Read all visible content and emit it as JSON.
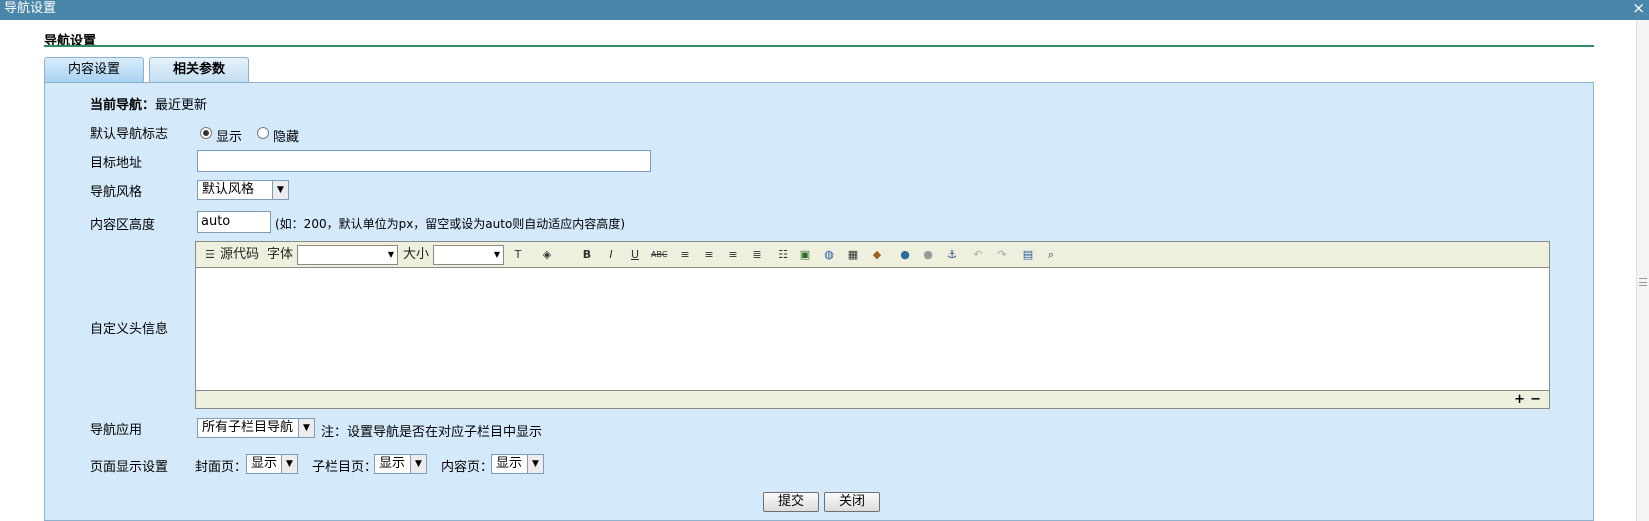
{
  "window": {
    "title": "导航设置",
    "close_glyph": "×"
  },
  "section": {
    "title": "导航设置"
  },
  "tabs": [
    {
      "label": "内容设置",
      "active": false
    },
    {
      "label": "相关参数",
      "active": true
    }
  ],
  "form": {
    "current_nav_label": "当前导航：",
    "current_nav_value": "最近更新",
    "default_flag_label": "默认导航标志",
    "flag_options": [
      {
        "label": "显示",
        "selected": true
      },
      {
        "label": "隐藏",
        "selected": false
      }
    ],
    "target_url_label": "目标地址",
    "target_url_value": "",
    "nav_style_label": "导航风格",
    "nav_style_value": "默认风格",
    "content_height_label": "内容区高度",
    "content_height_value": "auto",
    "content_height_hint": "(如：200，默认单位为px，留空或设为auto则自动适应内容高度)",
    "custom_header_label": "自定义头信息",
    "nav_apply_label": "导航应用",
    "nav_apply_value": "所有子栏目导航",
    "nav_apply_note": "注：设置导航是否在对应子栏目中显示",
    "page_display_label": "页面显示设置",
    "cover_page_label": "封面页：",
    "cover_page_value": "显示",
    "sub_page_label": "子栏目页：",
    "sub_page_value": "显示",
    "content_page_label": "内容页：",
    "content_page_value": "显示"
  },
  "editor": {
    "source_label": "源代码",
    "font_label": "字体",
    "font_value": "",
    "size_label": "大小",
    "size_value": "",
    "bold": "B",
    "italic": "I",
    "underline": "U",
    "strike": "ABC",
    "expand": "+",
    "shrink": "−"
  },
  "buttons": {
    "submit": "提交",
    "close": "关闭"
  },
  "colors": {
    "titlebar": "#4a86aa",
    "panel": "#d4e9f9",
    "title_line": "#2e8f62"
  }
}
